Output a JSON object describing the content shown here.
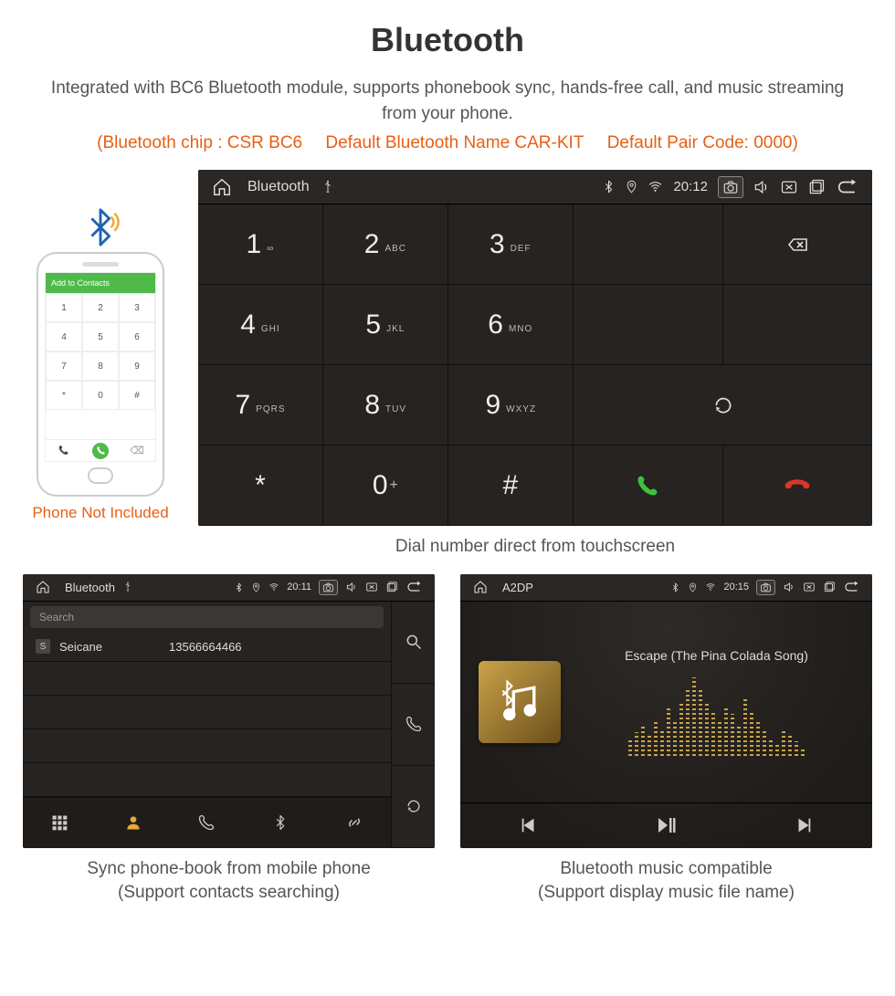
{
  "header": {
    "title": "Bluetooth",
    "subtitle": "Integrated with BC6 Bluetooth module, supports phonebook sync, hands-free call, and music streaming from your phone.",
    "spec_chip": "(Bluetooth chip : CSR BC6",
    "spec_name": "Default Bluetooth Name CAR-KIT",
    "spec_code": "Default Pair Code: 0000)"
  },
  "phone": {
    "caption": "Phone Not Included",
    "greenbar": "Add to Contacts",
    "pad": [
      "1",
      "2",
      "3",
      "4",
      "5",
      "6",
      "7",
      "8",
      "9",
      "*",
      "0",
      "#"
    ]
  },
  "dialer": {
    "statusbar": {
      "title": "Bluetooth",
      "time": "20:12"
    },
    "keys": [
      {
        "n": "1",
        "s": "∞"
      },
      {
        "n": "2",
        "s": "ABC"
      },
      {
        "n": "3",
        "s": "DEF"
      },
      {
        "n": "4",
        "s": "GHI"
      },
      {
        "n": "5",
        "s": "JKL"
      },
      {
        "n": "6",
        "s": "MNO"
      },
      {
        "n": "7",
        "s": "PQRS"
      },
      {
        "n": "8",
        "s": "TUV"
      },
      {
        "n": "9",
        "s": "WXYZ"
      },
      {
        "n": "*",
        "s": ""
      },
      {
        "n": "0",
        "s": "+",
        "sup": true
      },
      {
        "n": "#",
        "s": ""
      }
    ],
    "caption": "Dial number direct from touchscreen"
  },
  "contacts": {
    "statusbar": {
      "title": "Bluetooth",
      "time": "20:11"
    },
    "search_placeholder": "Search",
    "list": [
      {
        "badge": "S",
        "name": "Seicane",
        "number": "13566664466"
      }
    ],
    "caption_l1": "Sync phone-book from mobile phone",
    "caption_l2": "(Support contacts searching)"
  },
  "music": {
    "statusbar": {
      "title": "A2DP",
      "time": "20:15"
    },
    "track": "Escape (The Pina Colada Song)",
    "eq_heights": [
      18,
      26,
      34,
      22,
      40,
      30,
      52,
      38,
      60,
      72,
      86,
      74,
      60,
      48,
      40,
      54,
      46,
      34,
      62,
      50,
      38,
      28,
      20,
      14,
      30,
      22,
      16,
      10
    ],
    "caption_l1": "Bluetooth music compatible",
    "caption_l2": "(Support display music file name)"
  }
}
